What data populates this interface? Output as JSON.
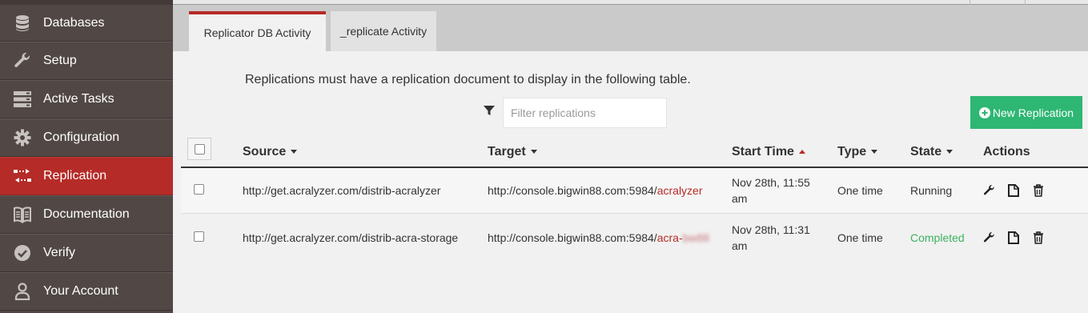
{
  "sidebar": {
    "items": [
      {
        "label": "Databases",
        "icon": "database-icon",
        "active": false
      },
      {
        "label": "Setup",
        "icon": "wrench-icon",
        "active": false
      },
      {
        "label": "Active Tasks",
        "icon": "server-icon",
        "active": false
      },
      {
        "label": "Configuration",
        "icon": "gear-icon",
        "active": false
      },
      {
        "label": "Replication",
        "icon": "replication-icon",
        "active": true
      },
      {
        "label": "Documentation",
        "icon": "book-icon",
        "active": false
      },
      {
        "label": "Verify",
        "icon": "check-circle-icon",
        "active": false
      },
      {
        "label": "Your Account",
        "icon": "user-icon",
        "active": false
      }
    ]
  },
  "tabs": [
    {
      "label": "Replicator DB Activity",
      "active": true
    },
    {
      "label": "_replicate Activity",
      "active": false
    }
  ],
  "info_text": "Replications must have a replication document to display in the following table.",
  "filter": {
    "placeholder": "Filter replications",
    "value": ""
  },
  "new_button_label": "New Replication",
  "table": {
    "columns": [
      "Source",
      "Target",
      "Start Time",
      "Type",
      "State",
      "Actions"
    ],
    "sort": {
      "column": "Start Time",
      "direction": "asc"
    },
    "rows": [
      {
        "source": "http://get.acralyzer.com/distrib-acralyzer",
        "target_prefix": "http://console.bigwin88.com:5984/",
        "target_db": "acralyzer",
        "target_db_blurred": "",
        "start_time_line1": "Nov 28th, 11:55",
        "start_time_line2": "am",
        "type": "One time",
        "state": "Running"
      },
      {
        "source": "http://get.acralyzer.com/distrib-acra-storage",
        "target_prefix": "http://console.bigwin88.com:5984/",
        "target_db": "acra-",
        "target_db_blurred": "bw88",
        "start_time_line1": "Nov 28th, 11:31",
        "start_time_line2": "am",
        "type": "One time",
        "state": "Completed"
      }
    ]
  },
  "colors": {
    "sidebar_bg": "#514845",
    "active_red": "#b52b27",
    "new_button_green": "#2eb673",
    "completed_green": "#3cb25e"
  }
}
